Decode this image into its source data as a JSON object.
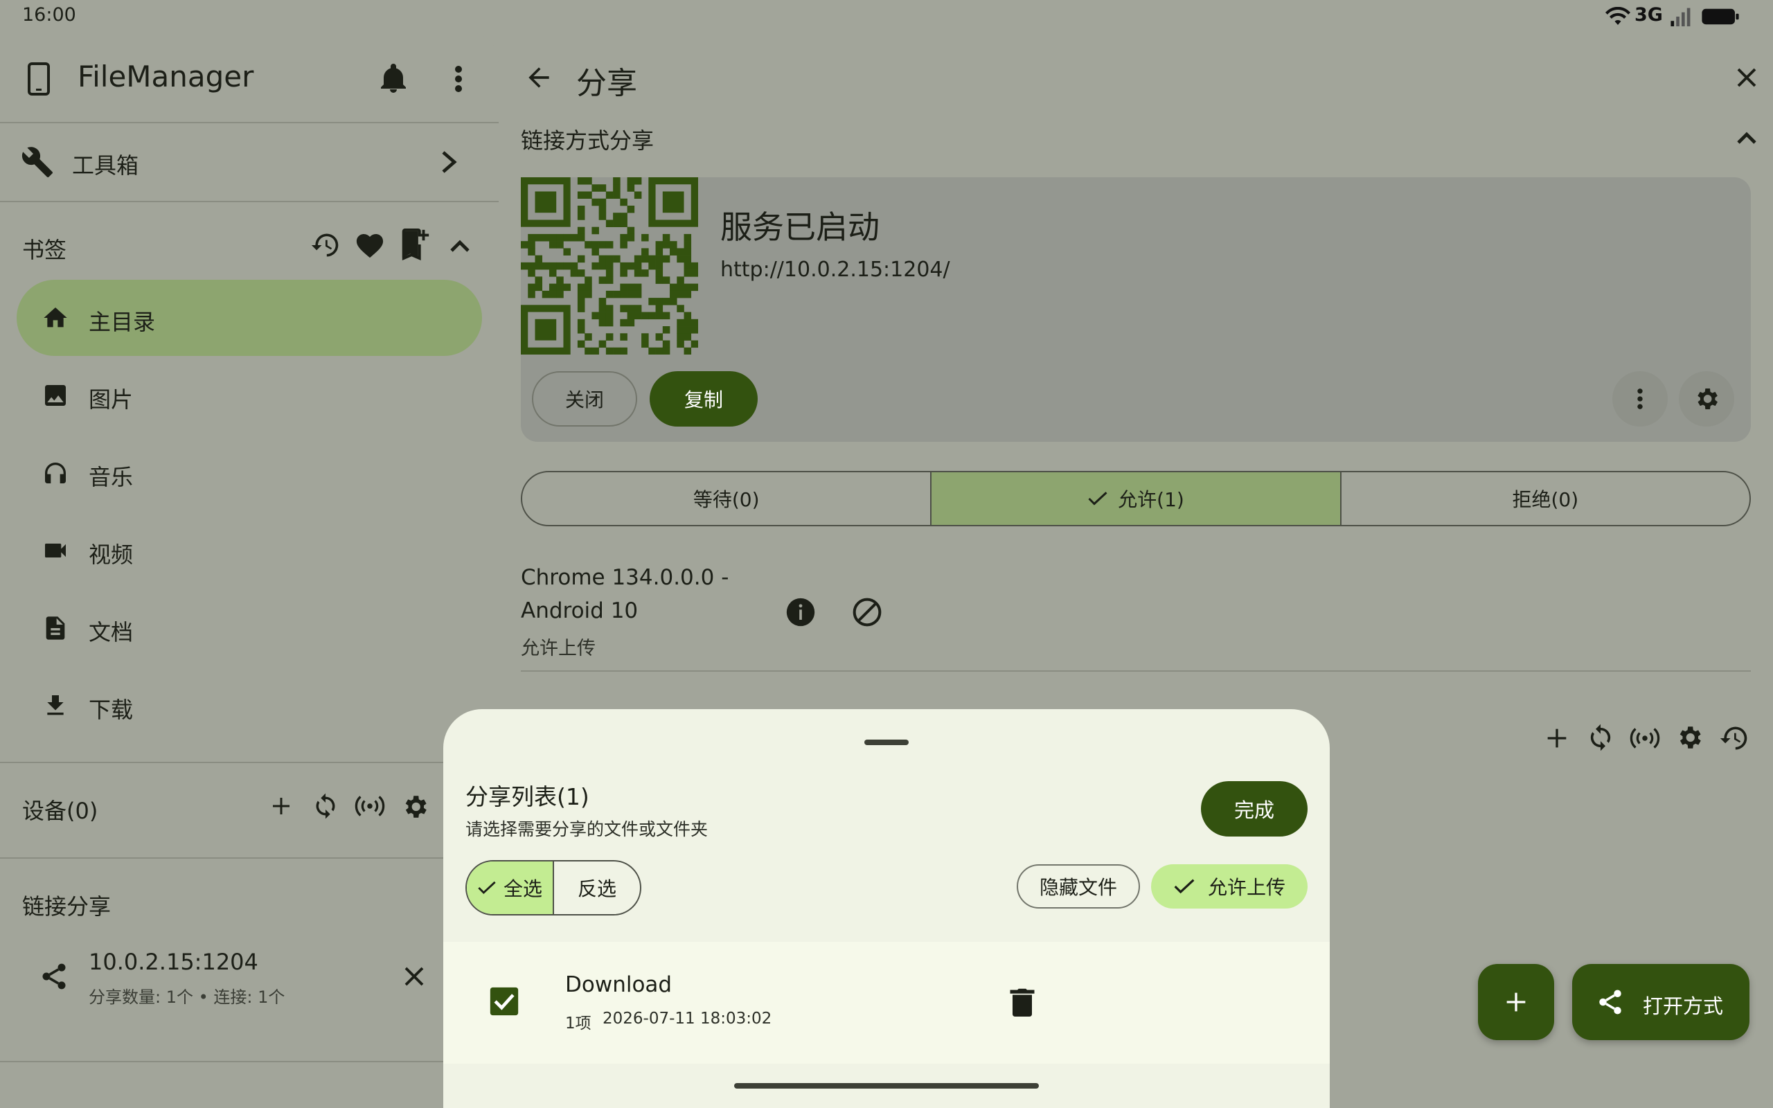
{
  "status_bar": {
    "time": "16:00",
    "network": "3G"
  },
  "drawer": {
    "app_title": "FileManager",
    "toolbox_label": "工具箱",
    "bookmarks_header": "书签",
    "nav_items": [
      {
        "label": "主目录",
        "icon": "home-icon",
        "active": true
      },
      {
        "label": "图片",
        "icon": "image-icon",
        "active": false
      },
      {
        "label": "音乐",
        "icon": "headphones-icon",
        "active": false
      },
      {
        "label": "视频",
        "icon": "video-icon",
        "active": false
      },
      {
        "label": "文档",
        "icon": "document-icon",
        "active": false
      },
      {
        "label": "下载",
        "icon": "download-icon",
        "active": false
      }
    ],
    "devices_header": "设备(0)",
    "link_share_header": "链接分享",
    "link_share_item": {
      "address": "10.0.2.15:1204",
      "detail": "分享数量: 1个 • 连接: 1个"
    }
  },
  "share_page": {
    "title": "分享",
    "section_title": "链接方式分享",
    "service_status": "服务已启动",
    "url": "http://10.0.2.15:1204/",
    "close_label": "关闭",
    "copy_label": "复制",
    "tabs": [
      {
        "label": "等待(0)",
        "active": false
      },
      {
        "label": "允许(1)",
        "active": true
      },
      {
        "label": "拒绝(0)",
        "active": false
      }
    ],
    "client": {
      "name_line1": "Chrome 134.0.0.0 -",
      "name_line2": "Android 10",
      "permission": "允许上传"
    }
  },
  "sheet": {
    "title": "分享列表(1)",
    "subtitle": "请选择需要分享的文件或文件夹",
    "done_label": "完成",
    "select_all_label": "全选",
    "invert_label": "反选",
    "hide_files_label": "隐藏文件",
    "allow_upload_label": "允许上传",
    "items": [
      {
        "name": "Download",
        "count": "1项",
        "date": "2026-07-11 18:03:02",
        "checked": true
      }
    ]
  },
  "fab": {
    "open_with_label": "打开方式"
  },
  "colors": {
    "accent": "#33520f",
    "active_bg": "#8da56f",
    "surface": "#f0f3e5",
    "scrim_bg": "#a2a59a"
  }
}
